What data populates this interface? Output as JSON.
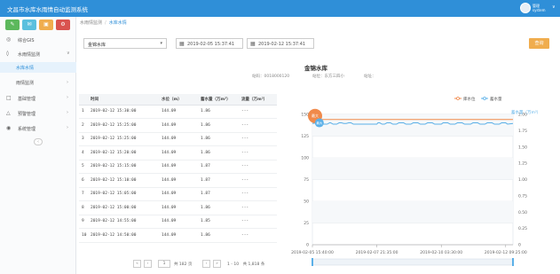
{
  "header": {
    "title": "文昌市水库水雨情自动监测系统",
    "user_name": "管理\nsystem",
    "user_chevron": "∨"
  },
  "quick_actions": [
    {
      "icon": "✎",
      "color": "#5cb85c"
    },
    {
      "icon": "✉",
      "color": "#5bc0de"
    },
    {
      "icon": "▣",
      "color": "#f0ad4e"
    },
    {
      "icon": "⚙",
      "color": "#d9534f"
    }
  ],
  "sidebar": {
    "items": [
      {
        "label": "综合GIS",
        "icon": "◎",
        "arrow": ""
      },
      {
        "label": "水雨情监测",
        "icon": "◊",
        "arrow": "∨"
      },
      {
        "label": "基础管理",
        "icon": "□",
        "arrow": "›"
      },
      {
        "label": "预警管理",
        "icon": "△",
        "arrow": "›"
      },
      {
        "label": "系统管理",
        "icon": "◉",
        "arrow": "›"
      }
    ],
    "sub_items": [
      {
        "label": "水库水情",
        "active": true,
        "arrow": ""
      },
      {
        "label": "雨情监测",
        "active": false,
        "arrow": "›"
      }
    ],
    "collapse_label": "‹"
  },
  "breadcrumb": {
    "items": [
      "水雨情监测",
      "水库水情"
    ],
    "separator": "/"
  },
  "filter": {
    "station_value": "金锦水库",
    "date_from": "2019-02-05 15:37:41",
    "date_to": "2019-02-12 15:37:41",
    "query_label": "查询"
  },
  "station": {
    "name": "金锦水库",
    "code_label": "站码：",
    "code_value": "0018000120",
    "location_label": "站位：",
    "location_value": "东方三四小",
    "address_label": "站址：",
    "address_value": ""
  },
  "table": {
    "columns": [
      "时间",
      "水位（m）",
      "蓄水量（万m³）",
      "流量（万m³）"
    ],
    "rows": [
      [
        "1",
        "2019-02-12 15:30:00",
        "144.09",
        "1.86",
        "---"
      ],
      [
        "2",
        "2019-02-12 15:25:00",
        "144.09",
        "1.86",
        "---"
      ],
      [
        "3",
        "2019-02-12 15:25:00",
        "144.09",
        "1.86",
        "---"
      ],
      [
        "4",
        "2019-02-12 15:20:00",
        "144.09",
        "1.86",
        "---"
      ],
      [
        "5",
        "2019-02-12 15:15:00",
        "144.09",
        "1.87",
        "---"
      ],
      [
        "6",
        "2019-02-12 15:10:00",
        "144.09",
        "1.87",
        "---"
      ],
      [
        "7",
        "2019-02-12 15:05:00",
        "144.09",
        "1.87",
        "---"
      ],
      [
        "8",
        "2019-02-12 15:00:00",
        "144.09",
        "1.86",
        "---"
      ],
      [
        "9",
        "2019-02-12 14:55:00",
        "144.09",
        "1.85",
        "---"
      ],
      [
        "10",
        "2019-02-12 14:50:00",
        "144.09",
        "1.86",
        "---"
      ]
    ]
  },
  "pager": {
    "first": "«",
    "prev": "‹",
    "page": "1",
    "of_label": "共 182 页",
    "next": "›",
    "last": "»",
    "summary": "1 - 10　共 1,818 条"
  },
  "chart_data": {
    "type": "line",
    "legend": [
      "库水位",
      "蓄水量"
    ],
    "legend_placement": "top-right",
    "colors": {
      "water_level": "#f08a4b",
      "storage": "#5bb0e8"
    },
    "y_left": {
      "ticks": [
        "150",
        "125",
        "100",
        "75",
        "50",
        "25",
        "0"
      ],
      "range": [
        0,
        150
      ]
    },
    "y_right": {
      "label": "蓄水量（万m³）",
      "ticks": [
        "2.00",
        "1.75",
        "1.50",
        "1.25",
        "1.00",
        "0.75",
        "0.50",
        "0.25",
        "0"
      ],
      "range": [
        0,
        2.0
      ]
    },
    "x_ticks": [
      "2019-02-05 15:40:00",
      "2019-02-07 21:35:00",
      "2019-02-10 03:30:00",
      "2019-02-12 09:25:00"
    ],
    "x_range": [
      "2019-02-05 15:40:00",
      "2019-02-12 15:30:00"
    ],
    "grid": true,
    "markers": [
      {
        "series": "库水位",
        "label": "最大",
        "value": 144.09
      },
      {
        "series": "蓄水量",
        "label": "最大",
        "value": 1.87
      }
    ],
    "series": [
      {
        "name": "库水位",
        "x": [
          "2019-02-05 15:40:00",
          "2019-02-12 15:30:00"
        ],
        "values": [
          144.09,
          144.09
        ]
      },
      {
        "name": "蓄水量",
        "x": [
          "2019-02-05 15:40:00",
          "2019-02-05 20:00:00",
          "2019-02-06 00:00:00",
          "2019-02-06 01:00:00",
          "2019-02-06 04:00:00",
          "2019-02-06 06:00:00",
          "2019-02-06 07:00:00",
          "2019-02-06 09:00:00",
          "2019-02-06 12:00:00",
          "2019-02-06 14:00:00",
          "2019-02-06 16:00:00",
          "2019-02-06 18:00:00",
          "2019-02-06 20:00:00",
          "2019-02-06 22:00:00",
          "2019-02-07 00:00:00",
          "2019-02-07 02:00:00",
          "2019-02-07 21:35:00",
          "2019-02-07 22:30:00",
          "2019-02-08 00:00:00",
          "2019-02-08 02:00:00",
          "2019-02-08 04:00:00",
          "2019-02-08 06:00:00",
          "2019-02-08 09:00:00",
          "2019-02-08 11:00:00",
          "2019-02-08 14:00:00",
          "2019-02-08 16:00:00",
          "2019-02-08 20:00:00",
          "2019-02-08 22:00:00",
          "2019-02-09 02:00:00",
          "2019-02-09 04:00:00",
          "2019-02-09 08:00:00",
          "2019-02-09 10:00:00",
          "2019-02-09 14:00:00",
          "2019-02-09 16:00:00",
          "2019-02-09 20:00:00",
          "2019-02-09 22:00:00",
          "2019-02-10 03:30:00",
          "2019-02-10 05:00:00",
          "2019-02-10 09:00:00",
          "2019-02-10 11:00:00",
          "2019-02-10 15:00:00",
          "2019-02-10 17:00:00",
          "2019-02-10 21:00:00",
          "2019-02-10 23:00:00",
          "2019-02-11 04:00:00",
          "2019-02-11 06:00:00",
          "2019-02-11 10:00:00",
          "2019-02-11 12:00:00",
          "2019-02-11 16:00:00",
          "2019-02-11 18:00:00",
          "2019-02-11 22:00:00",
          "2019-02-12 00:00:00",
          "2019-02-12 04:00:00",
          "2019-02-12 06:00:00",
          "2019-02-12 09:25:00",
          "2019-02-12 11:00:00",
          "2019-02-12 15:30:00"
        ],
        "values": [
          1.86,
          1.87,
          1.87,
          1.85,
          1.85,
          1.87,
          1.87,
          1.85,
          1.85,
          1.87,
          1.87,
          1.86,
          1.86,
          1.87,
          1.87,
          1.85,
          1.85,
          1.87,
          1.87,
          1.85,
          1.85,
          1.87,
          1.87,
          1.85,
          1.85,
          1.87,
          1.87,
          1.85,
          1.85,
          1.87,
          1.87,
          1.85,
          1.85,
          1.87,
          1.87,
          1.85,
          1.85,
          1.87,
          1.87,
          1.85,
          1.85,
          1.87,
          1.87,
          1.85,
          1.85,
          1.87,
          1.87,
          1.85,
          1.85,
          1.87,
          1.87,
          1.85,
          1.85,
          1.87,
          1.87,
          1.85,
          1.86
        ]
      }
    ]
  }
}
